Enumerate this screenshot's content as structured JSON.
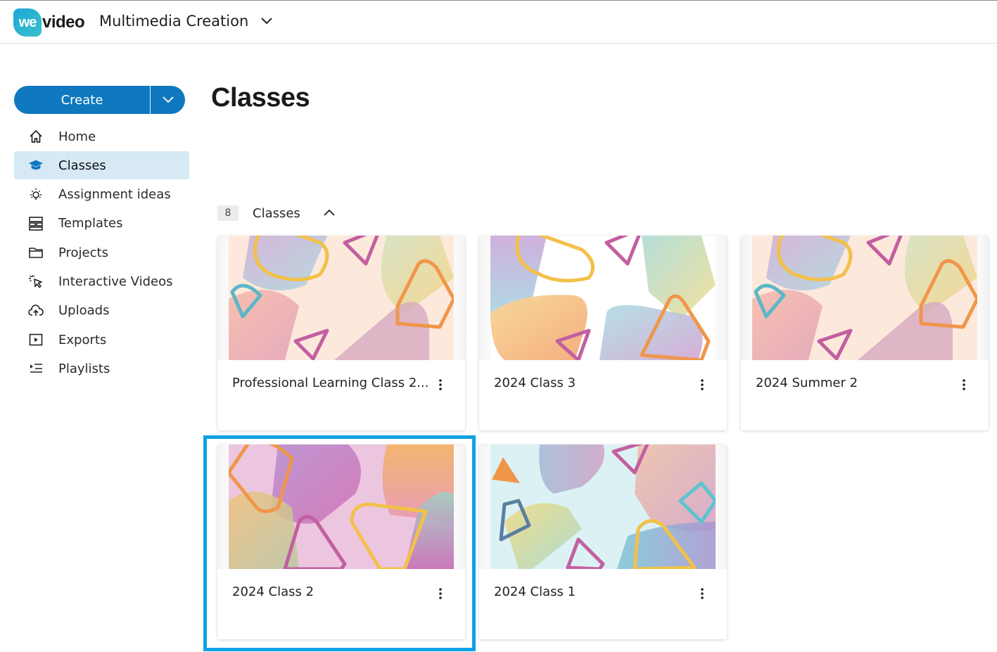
{
  "brand": {
    "logo_badge": "we",
    "logo_rest": "video",
    "accent": "#0f78be"
  },
  "header": {
    "workspace_name": "Multimedia Creation"
  },
  "sidebar": {
    "create_label": "Create",
    "items": [
      {
        "label": "Home",
        "icon": "home-icon"
      },
      {
        "label": "Classes",
        "icon": "graduation-cap-icon",
        "active": true
      },
      {
        "label": "Assignment ideas",
        "icon": "lightbulb-icon"
      },
      {
        "label": "Templates",
        "icon": "templates-icon"
      },
      {
        "label": "Projects",
        "icon": "folder-icon"
      },
      {
        "label": "Interactive Videos",
        "icon": "cursor-click-icon"
      },
      {
        "label": "Uploads",
        "icon": "cloud-upload-icon"
      },
      {
        "label": "Exports",
        "icon": "play-square-icon"
      },
      {
        "label": "Playlists",
        "icon": "playlist-icon"
      }
    ]
  },
  "main": {
    "title": "Classes",
    "section": {
      "count": "8",
      "label": "Classes"
    },
    "classes": [
      {
        "name": "Professional Learning Class 2...",
        "theme": "peach"
      },
      {
        "name": "2024 Class 3",
        "theme": "white"
      },
      {
        "name": "2024 Summer 2",
        "theme": "peach"
      },
      {
        "name": "2024 Class 2",
        "theme": "pink",
        "highlighted": true
      },
      {
        "name": "2024 Class 1",
        "theme": "aqua"
      }
    ]
  }
}
